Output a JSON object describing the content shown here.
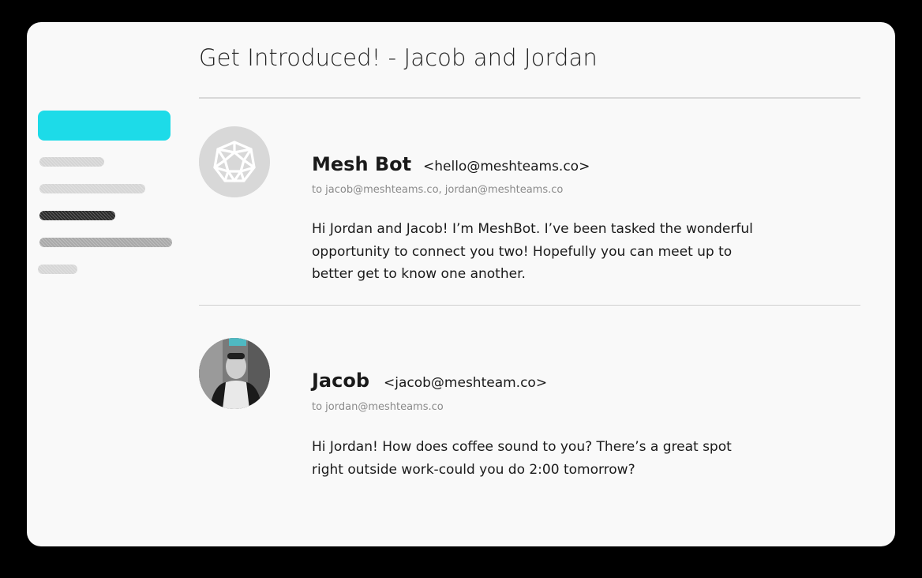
{
  "thread": {
    "title": "Get Introduced! - Jacob and Jordan"
  },
  "sidebar": {
    "items": [
      {
        "state": "active"
      },
      {
        "state": "placeholder"
      },
      {
        "state": "placeholder"
      },
      {
        "state": "placeholder-dark"
      },
      {
        "state": "placeholder"
      },
      {
        "state": "placeholder"
      }
    ],
    "accent_color": "#1ddbe8"
  },
  "messages": [
    {
      "sender_name": "Mesh Bot",
      "sender_email": "<hello@meshteams.co>",
      "recipients": "to jacob@meshteams.co, jordan@meshteams.co",
      "body": "Hi Jordan and Jacob! I’m MeshBot. I’ve been tasked the wonderful opportunity to connect you two! Hopefully you can meet up to better get to know one another.",
      "avatar": "mesh-logo-icon"
    },
    {
      "sender_name": "Jacob",
      "sender_email": "<jacob@meshteam.co>",
      "recipients": "to jordan@meshteams.co",
      "body": "Hi Jordan! How does coffee sound to you? There’s a great spot right outside work-could you do 2:00 tomorrow?",
      "avatar": "user-photo"
    }
  ]
}
